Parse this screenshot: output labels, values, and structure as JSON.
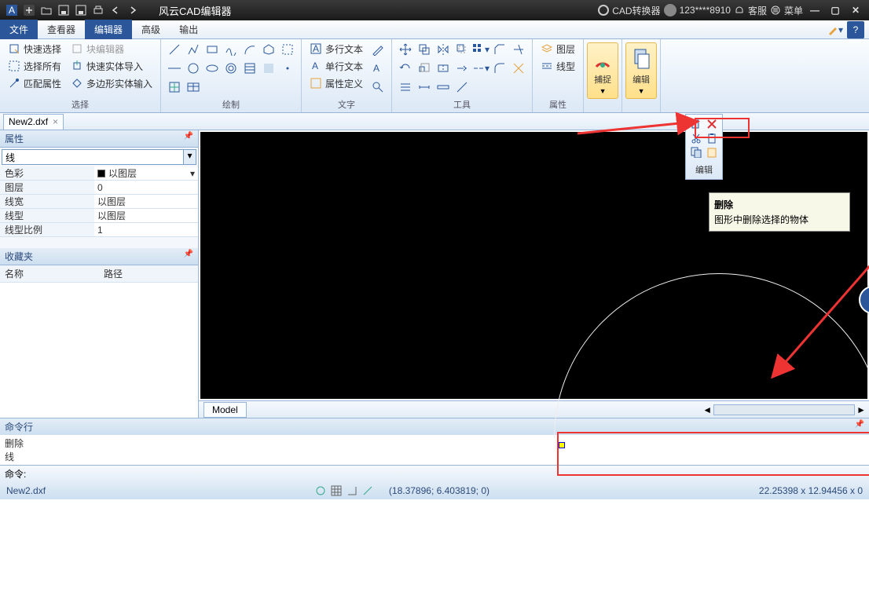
{
  "titlebar": {
    "app_title": "风云CAD编辑器",
    "convert": "CAD转换器",
    "user": "123****8910",
    "service": "客服",
    "menu": "菜单"
  },
  "menu": {
    "file": "文件",
    "viewer": "查看器",
    "editor": "编辑器",
    "advanced": "高级",
    "output": "输出"
  },
  "ribbon": {
    "sel": {
      "quick": "快速选择",
      "block": "块编辑器",
      "all": "选择所有",
      "fastimp": "快速实体导入",
      "match": "匹配属性",
      "polyimp": "多边形实体输入",
      "group": "选择"
    },
    "draw": {
      "group": "绘制"
    },
    "text": {
      "mtext": "多行文本",
      "stext": "单行文本",
      "attdef": "属性定义",
      "group": "文字"
    },
    "tool": {
      "group": "工具"
    },
    "layer": {
      "layer": "图层",
      "linetype": "线型",
      "group": "属性"
    },
    "snap": {
      "label": "捕捉"
    },
    "edit": {
      "label": "编辑"
    }
  },
  "doc": {
    "name": "New2.dxf"
  },
  "props": {
    "title": "属性",
    "object": "线",
    "color_n": "色彩",
    "color_v": "以图层",
    "layer_n": "图层",
    "layer_v": "0",
    "lw_n": "线宽",
    "lw_v": "以图层",
    "lt_n": "线型",
    "lt_v": "以图层",
    "ls_n": "线型比例",
    "ls_v": "1"
  },
  "fav": {
    "title": "收藏夹",
    "name": "名称",
    "path": "路径"
  },
  "model": {
    "tab": "Model"
  },
  "cmd": {
    "title": "命令行",
    "l1": "删除",
    "l2": "线",
    "prompt": "命令:"
  },
  "status": {
    "file": "New2.dxf",
    "coords": "(18.37896; 6.403819; 0)",
    "dims": "22.25398 x 12.94456 x 0"
  },
  "editfly": {
    "label": "编辑"
  },
  "tooltip": {
    "title": "删除",
    "desc": "图形中删除选择的物体"
  }
}
